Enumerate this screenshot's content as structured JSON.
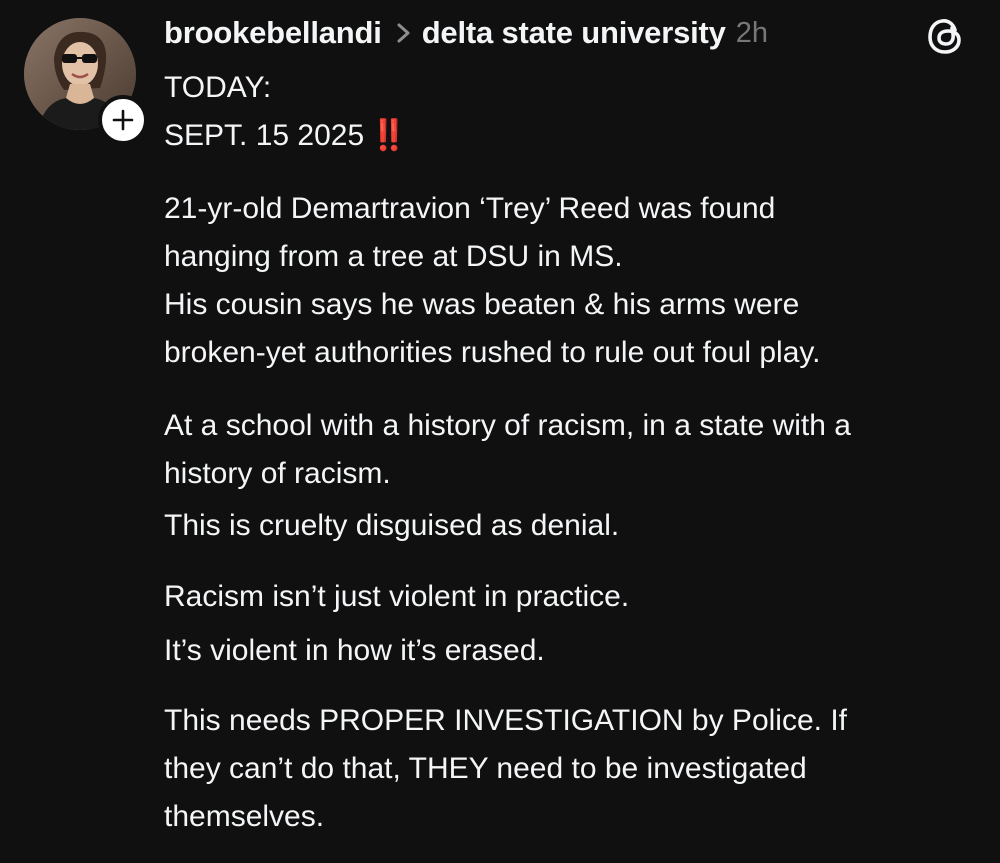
{
  "post": {
    "author": "brookebellandi",
    "community": "delta state university",
    "time_ago": "2h",
    "icons": {
      "avatar": "profile-photo",
      "follow": "plus-icon",
      "separator": "chevron-right-icon",
      "brand": "threads-logo-icon",
      "emphasis": "double-exclamation-emoji"
    },
    "emphasis_emoji": "‼️",
    "lines": {
      "today": "TODAY:",
      "date": "SEPT. 15 2025",
      "p1_l1": "21-yr-old Demartravion ‘Trey’ Reed was found",
      "p1_l2": "hanging from a tree at DSU in MS.",
      "p1_l3": "His cousin says he was beaten & his arms were",
      "p1_l4": "broken-yet authorities rushed to rule out foul play.",
      "p2_l1": "At a school with a history of racism, in a state with a",
      "p2_l2": "history of racism.",
      "p2_l3": "This is cruelty disguised as denial.",
      "p3_l1": "Racism isn’t just violent in practice.",
      "p3_l2": "It’s violent in how it’s erased.",
      "p4_l1": "This needs PROPER INVESTIGATION by Police. If",
      "p4_l2": "they can’t do that, THEY need to be investigated",
      "p4_l3": "themselves."
    }
  },
  "colors": {
    "background": "#101010",
    "text": "#f3f5f7",
    "secondary_text": "#777777",
    "emoji_red": "#e0242b"
  }
}
